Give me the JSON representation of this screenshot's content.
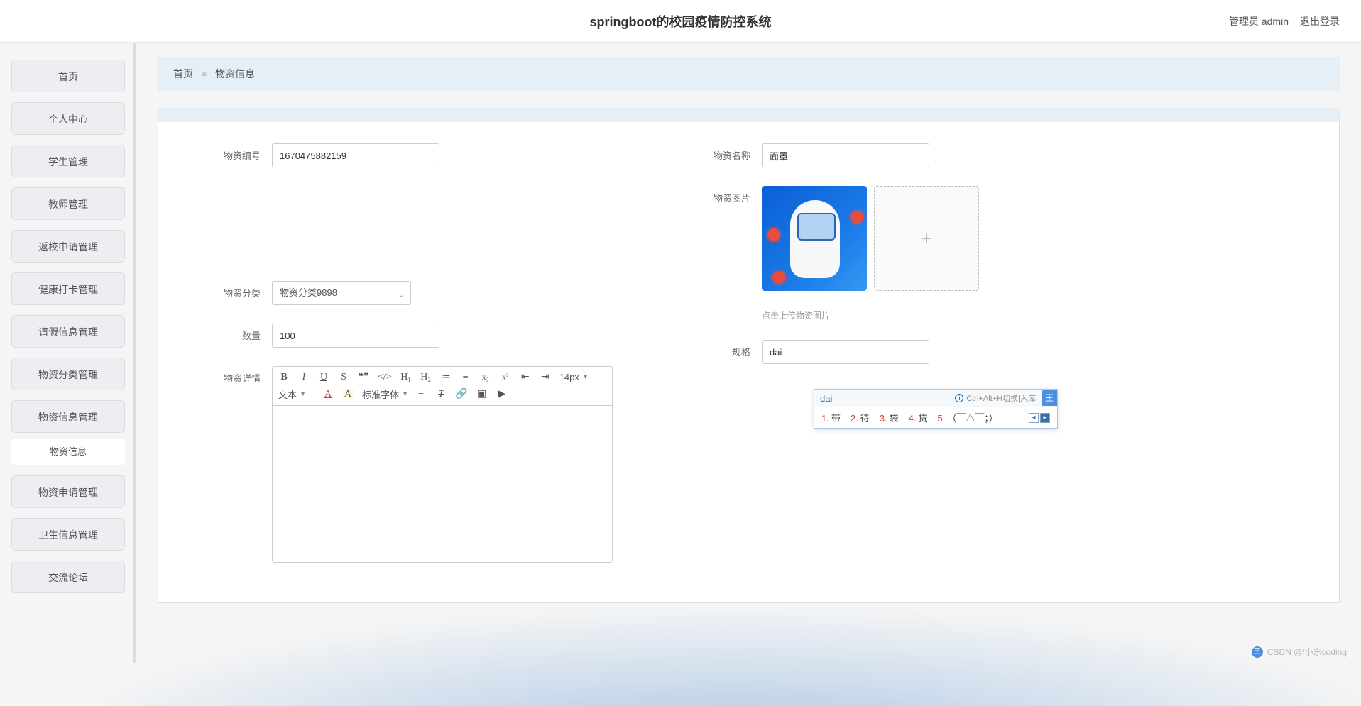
{
  "header": {
    "title": "springboot的校园疫情防控系统",
    "user_label": "管理员 admin",
    "logout": "退出登录"
  },
  "sidebar": {
    "items": [
      "首页",
      "个人中心",
      "学生管理",
      "教师管理",
      "返校申请管理",
      "健康打卡管理",
      "请假信息管理",
      "物资分类管理",
      "物资信息管理",
      "物资申请管理",
      "卫生信息管理",
      "交流论坛"
    ],
    "sub_item": "物资信息"
  },
  "breadcrumb": {
    "home": "首页",
    "current": "物资信息"
  },
  "form": {
    "code_label": "物资编号",
    "code_value": "1670475882159",
    "name_label": "物资名称",
    "name_value": "面罩",
    "image_label": "物资图片",
    "upload_hint": "点击上传物资图片",
    "category_label": "物资分类",
    "category_value": "物资分类9898",
    "qty_label": "数量",
    "qty_value": "100",
    "spec_label": "规格",
    "spec_value": "dai",
    "detail_label": "物资详情",
    "editor": {
      "font_size": "14px",
      "text_label": "文本",
      "font_family": "标准字体"
    }
  },
  "ime": {
    "typed": "dai",
    "shortcut": "Ctrl+Alt+H切换|入库",
    "badge": "王",
    "candidates": [
      {
        "n": "1.",
        "w": "带"
      },
      {
        "n": "2.",
        "w": "待"
      },
      {
        "n": "3.",
        "w": "袋"
      },
      {
        "n": "4.",
        "w": "贷"
      },
      {
        "n": "5.",
        "w": "（￣△￣；）"
      }
    ]
  },
  "watermark": "CSDN @/小东coding"
}
